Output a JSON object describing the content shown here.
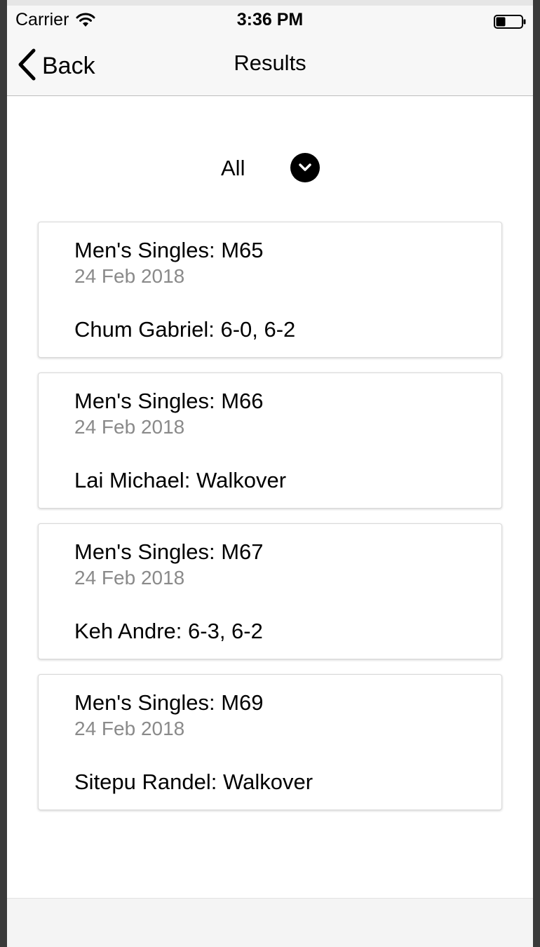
{
  "status_bar": {
    "carrier": "Carrier",
    "time": "3:36 PM"
  },
  "nav": {
    "back_label": "Back",
    "title": "Results"
  },
  "filter": {
    "selected": "All"
  },
  "results": [
    {
      "title": "Men's Singles: M65",
      "date": "24 Feb 2018",
      "result": "Chum Gabriel: 6-0, 6-2"
    },
    {
      "title": "Men's Singles: M66",
      "date": "24 Feb 2018",
      "result": "Lai Michael: Walkover"
    },
    {
      "title": "Men's Singles: M67",
      "date": "24 Feb 2018",
      "result": "Keh Andre: 6-3, 6-2"
    },
    {
      "title": "Men's Singles: M69",
      "date": "24 Feb 2018",
      "result": "Sitepu Randel: Walkover"
    }
  ],
  "icons": {
    "wifi": "wifi-icon",
    "battery": "battery-icon",
    "back": "chevron-left-icon",
    "dropdown": "chevron-down-circle-icon"
  }
}
